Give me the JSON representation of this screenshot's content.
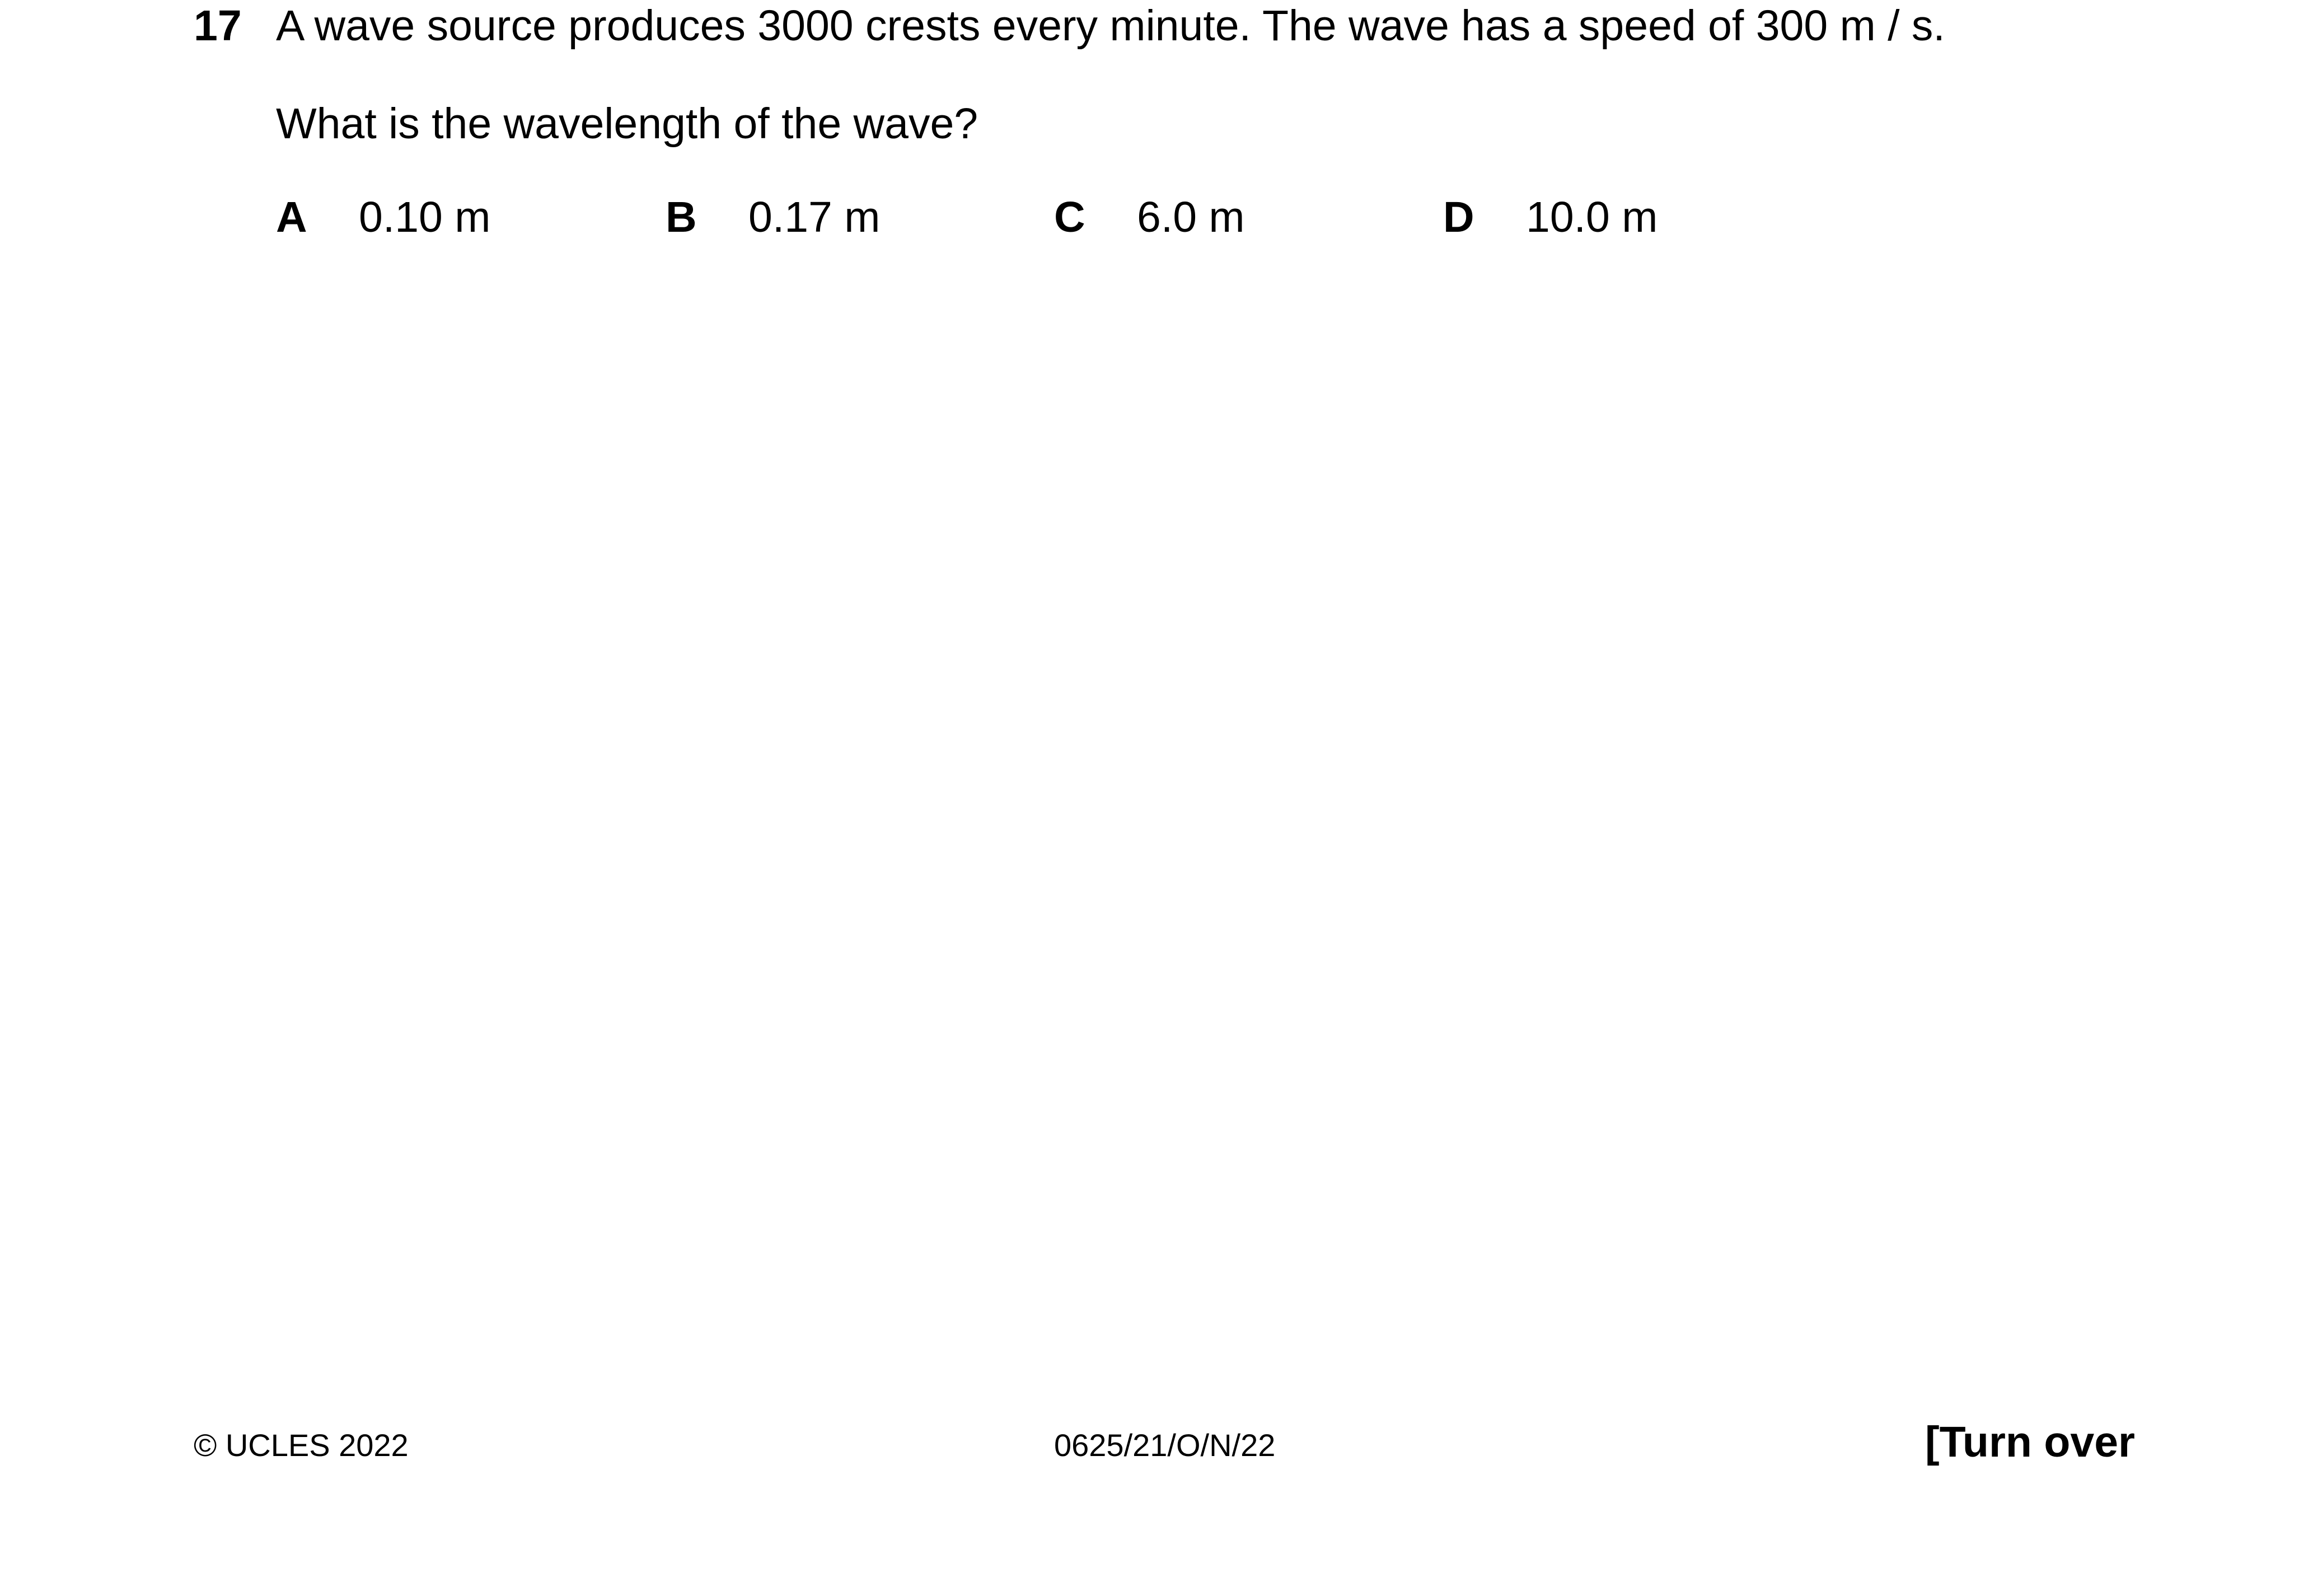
{
  "question": {
    "number": "17",
    "stem": "A wave source produces 3000 crests every minute. The wave has a speed of 300 m / s.",
    "prompt": "What is the wavelength of the wave?",
    "options": [
      {
        "letter": "A",
        "value": "0.10 m"
      },
      {
        "letter": "B",
        "value": "0.17 m"
      },
      {
        "letter": "C",
        "value": "6.0 m"
      },
      {
        "letter": "D",
        "value": "10.0 m"
      }
    ]
  },
  "footer": {
    "copyright": "© UCLES 2022",
    "code": "0625/21/O/N/22",
    "turn_over": "[Turn over"
  }
}
